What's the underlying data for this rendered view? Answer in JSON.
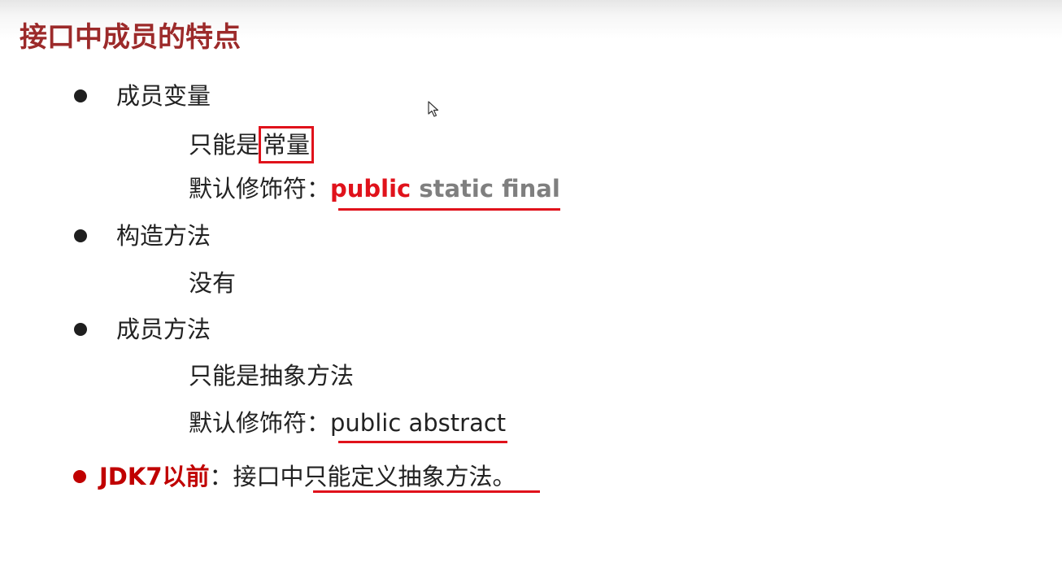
{
  "title": "接口中成员的特点",
  "member_variables": {
    "heading": "成员变量",
    "line1_prefix": "只能是",
    "line1_boxed": "常量",
    "line2_prefix": "默认修饰符：",
    "line2_kw_public": "public",
    "line2_kw_rest": " static final"
  },
  "constructor": {
    "heading": "构造方法",
    "line1": "没有"
  },
  "member_methods": {
    "heading": "成员方法",
    "line1": "只能是抽象方法",
    "line2_prefix": "默认修饰符：",
    "line2_value": "public abstract"
  },
  "jdk7": {
    "label": "JDK7以前",
    "colon": "：",
    "text_prefix": "接口中",
    "text_underlined": "只能定义抽象方法。"
  },
  "colors": {
    "title": "#9c2a2a",
    "accent_red": "#e0121b",
    "keyword_gray": "#7f7f7f",
    "jdk_red": "#c00000"
  },
  "icons": {
    "bullet": "filled-circle",
    "cursor": "mouse-pointer-icon"
  }
}
